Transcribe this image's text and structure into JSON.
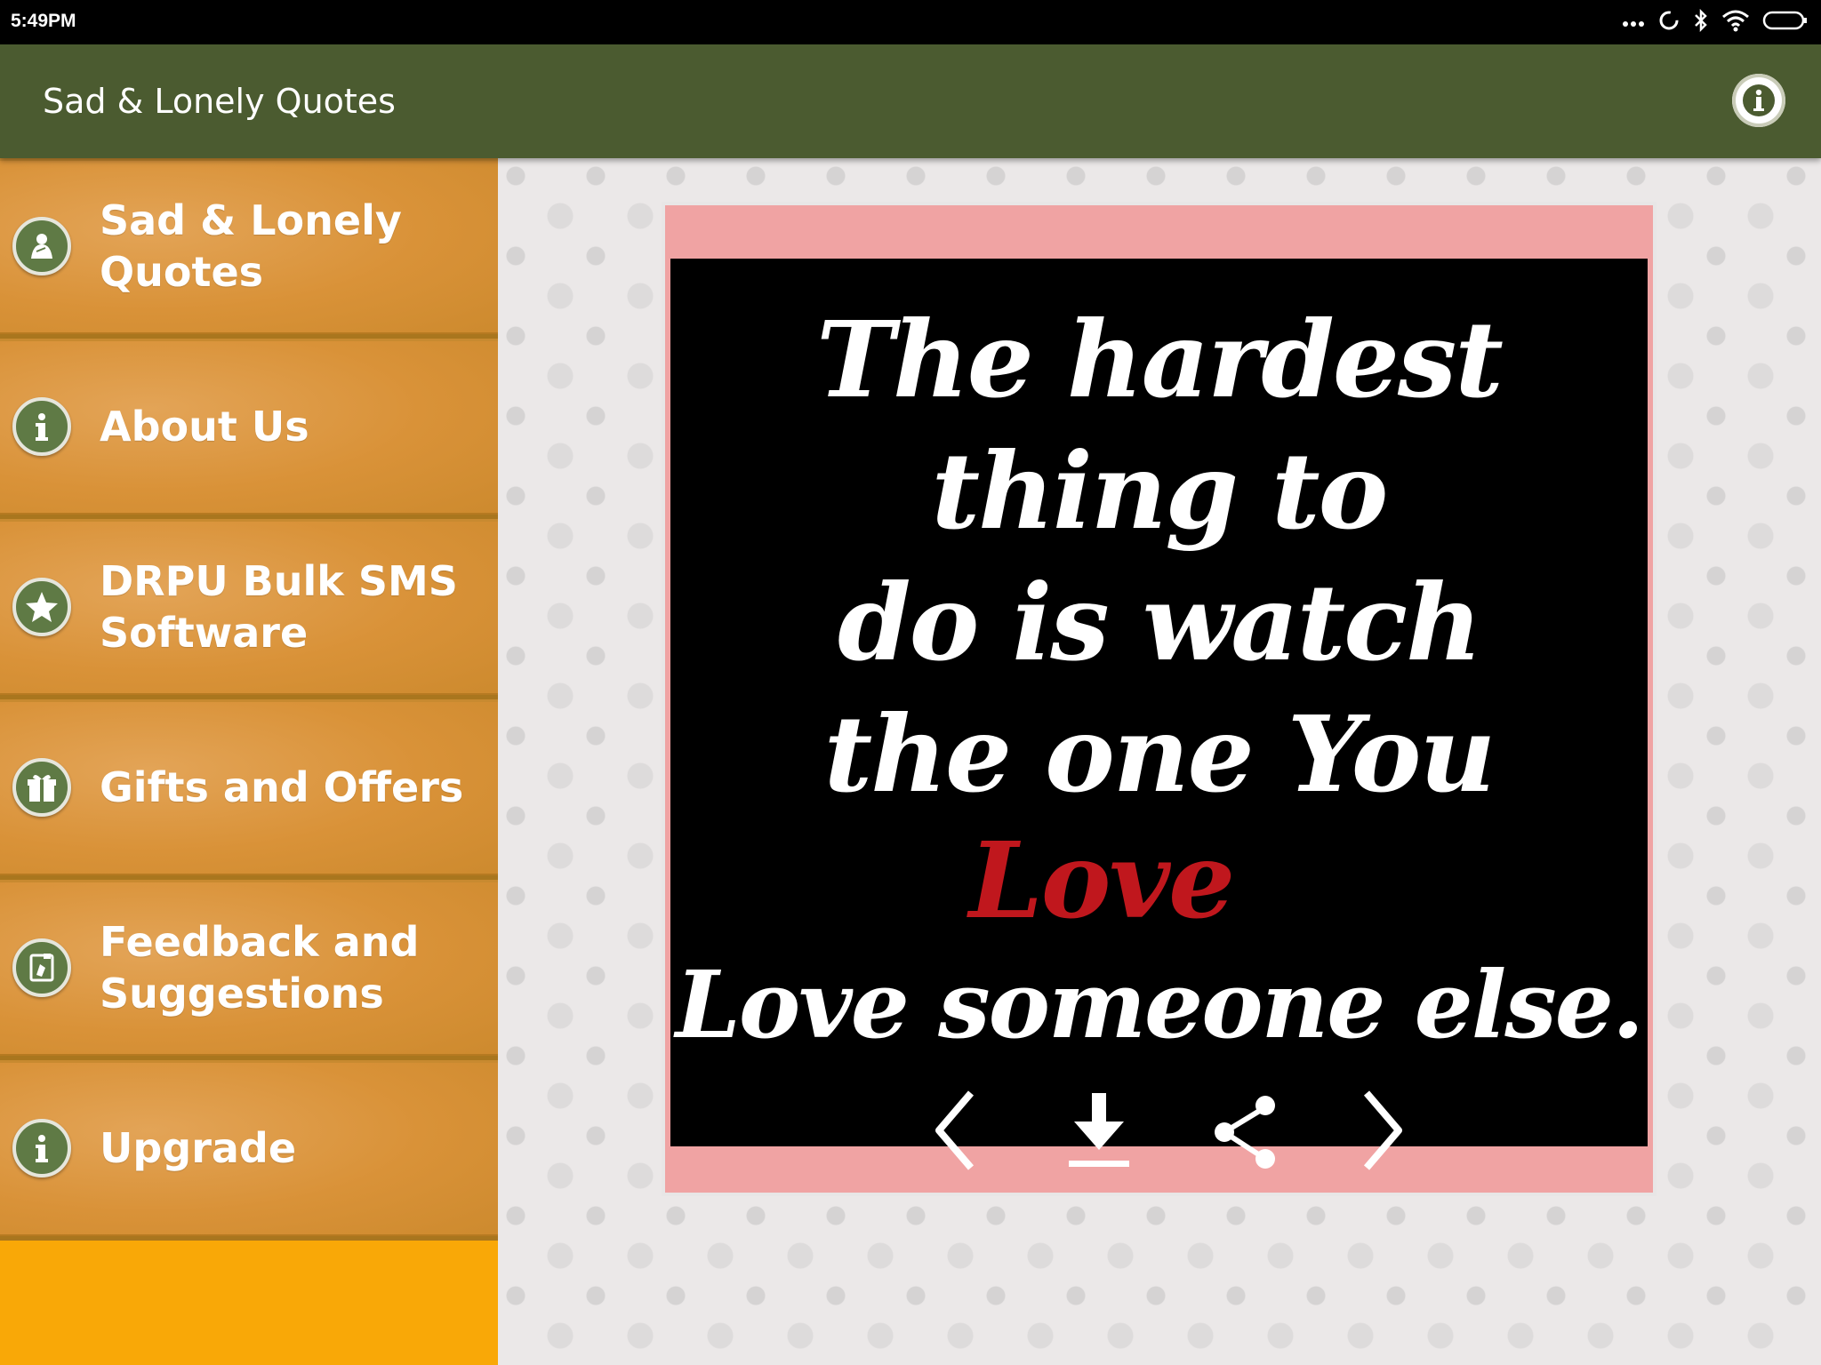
{
  "status_bar": {
    "time": "5:49PM"
  },
  "app_bar": {
    "title": "Sad & Lonely Quotes"
  },
  "sidebar": {
    "items": [
      {
        "label": "Sad & Lonely Quotes",
        "icon": "sad-person-icon"
      },
      {
        "label": "About Us",
        "icon": "info-icon"
      },
      {
        "label": "DRPU Bulk SMS Software",
        "icon": "star-icon"
      },
      {
        "label": "Gifts and Offers",
        "icon": "gift-icon"
      },
      {
        "label": "Feedback and Suggestions",
        "icon": "feedback-icon"
      },
      {
        "label": "Upgrade",
        "icon": "info-icon"
      }
    ]
  },
  "quote": {
    "lines": [
      "The  hardest",
      "thing to",
      "do is watch",
      "the one You"
    ],
    "highlight": "Love",
    "last_line": "Love someone else.",
    "highlight_color": "#c0171d"
  },
  "controls": [
    "previous-icon",
    "download-icon",
    "share-icon",
    "next-icon"
  ],
  "colors": {
    "app_bar": "#4b5b30",
    "sidebar_accent": "#f9a807",
    "card": "#f0a3a3"
  }
}
